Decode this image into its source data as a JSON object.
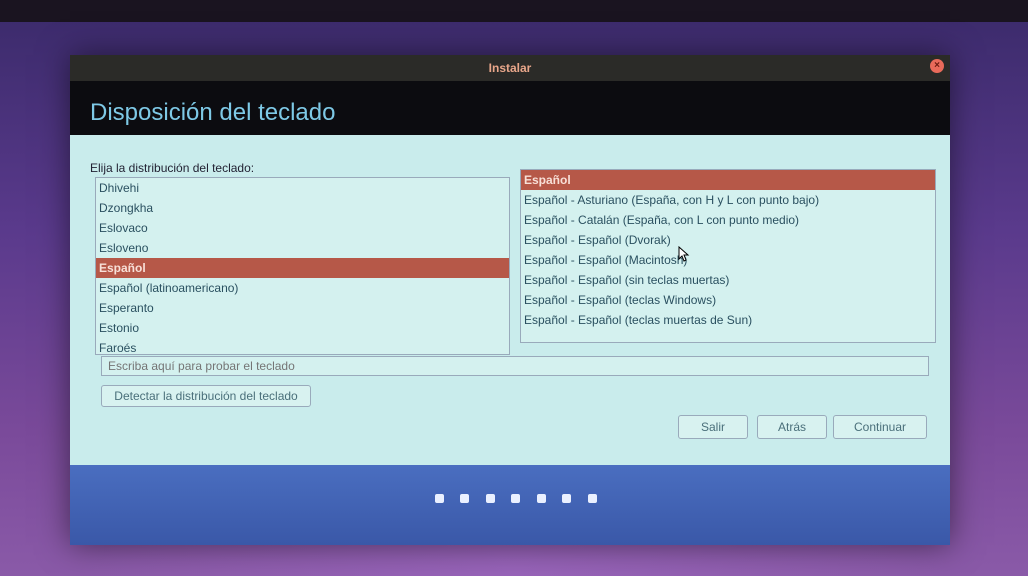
{
  "window": {
    "title": "Instalar",
    "close": "×"
  },
  "header": {
    "title": "Disposición del teclado"
  },
  "instruction": "Elija la distribución del teclado:",
  "layouts": {
    "items": [
      "Dhivehi",
      "Dzongkha",
      "Eslovaco",
      "Esloveno",
      "Español",
      "Español (latinoamericano)",
      "Esperanto",
      "Estonio",
      "Faroés"
    ],
    "selected": "Español"
  },
  "variants": {
    "items": [
      "Español",
      "Español - Asturiano (España, con H y L con punto bajo)",
      "Español - Catalán (España, con L con punto medio)",
      "Español - Español (Dvorak)",
      "Español - Español (Macintosh)",
      "Español - Español (sin teclas muertas)",
      "Español - Español (teclas Windows)",
      "Español - Español (teclas muertas de Sun)"
    ],
    "selected": "Español"
  },
  "test": {
    "placeholder": "Escriba aquí para probar el teclado"
  },
  "buttons": {
    "detect": "Detectar la distribución del teclado",
    "exit": "Salir",
    "back": "Atrás",
    "continue": "Continuar"
  },
  "progress": {
    "total": 7,
    "current": 1
  }
}
